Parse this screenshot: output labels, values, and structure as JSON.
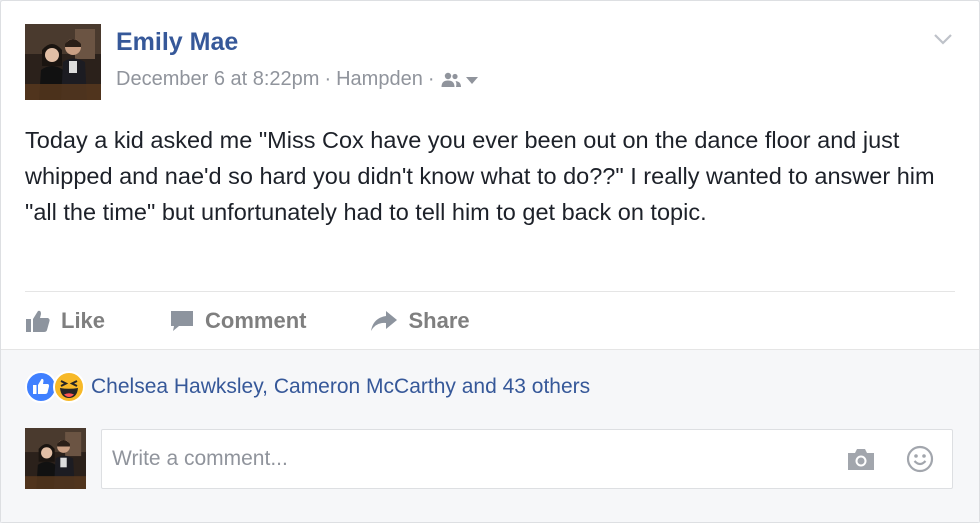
{
  "post": {
    "author": "Emily Mae",
    "timestamp": "December 6 at 8:22pm",
    "separator": "·",
    "location": "Hampden",
    "audience_icon": "friends-icon",
    "text": "Today a kid asked me \"Miss Cox have you ever been out on the dance floor and just whipped and nae'd so hard you didn't know what to do??\" I really wanted to answer him \"all the time\" but unfortunately had to tell him to get back on topic."
  },
  "actions": {
    "like_label": "Like",
    "comment_label": "Comment",
    "share_label": "Share"
  },
  "reactions": {
    "icons": [
      "like-reaction-icon",
      "haha-reaction-icon"
    ],
    "summary": "Chelsea Hawksley, Cameron McCarthy and 43 others"
  },
  "comment_composer": {
    "placeholder": "Write a comment..."
  },
  "colors": {
    "link": "#365899",
    "meta": "#90949c",
    "like_blue": "#4080ff",
    "haha_yellow": "#f7b928"
  }
}
